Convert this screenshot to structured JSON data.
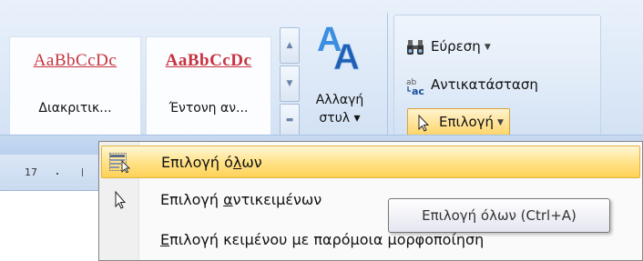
{
  "styles_gallery": {
    "items": [
      {
        "sample": "AaBbCcDc",
        "label": "Διακριτικ..."
      },
      {
        "sample": "AaBbCcDc",
        "label": "Έντονη αν..."
      }
    ]
  },
  "change_styles": {
    "line1": "Αλλαγή",
    "line2": "στυλ ▾"
  },
  "editing": {
    "find": "Εύρεση",
    "replace": "Αντικατάσταση",
    "select": "Επιλογή"
  },
  "ruler": {
    "number": "17"
  },
  "select_menu": {
    "items": [
      {
        "pre": "Επιλογή ό",
        "key": "λ",
        "post": "ων"
      },
      {
        "pre": "Επιλογή ",
        "key": "α",
        "post": "ντικειμένων"
      },
      {
        "pre": "",
        "key": "Ε",
        "post": "πιλογή κειμένου με παρόμοια μορφοποίηση"
      }
    ],
    "highlighted_index": 0
  },
  "tooltip": {
    "text": "Επιλογή όλων (Ctrl+A)"
  },
  "colors": {
    "accent_red": "#c8333f",
    "highlight": "#ffd257",
    "ribbon": "#dce8f7"
  }
}
